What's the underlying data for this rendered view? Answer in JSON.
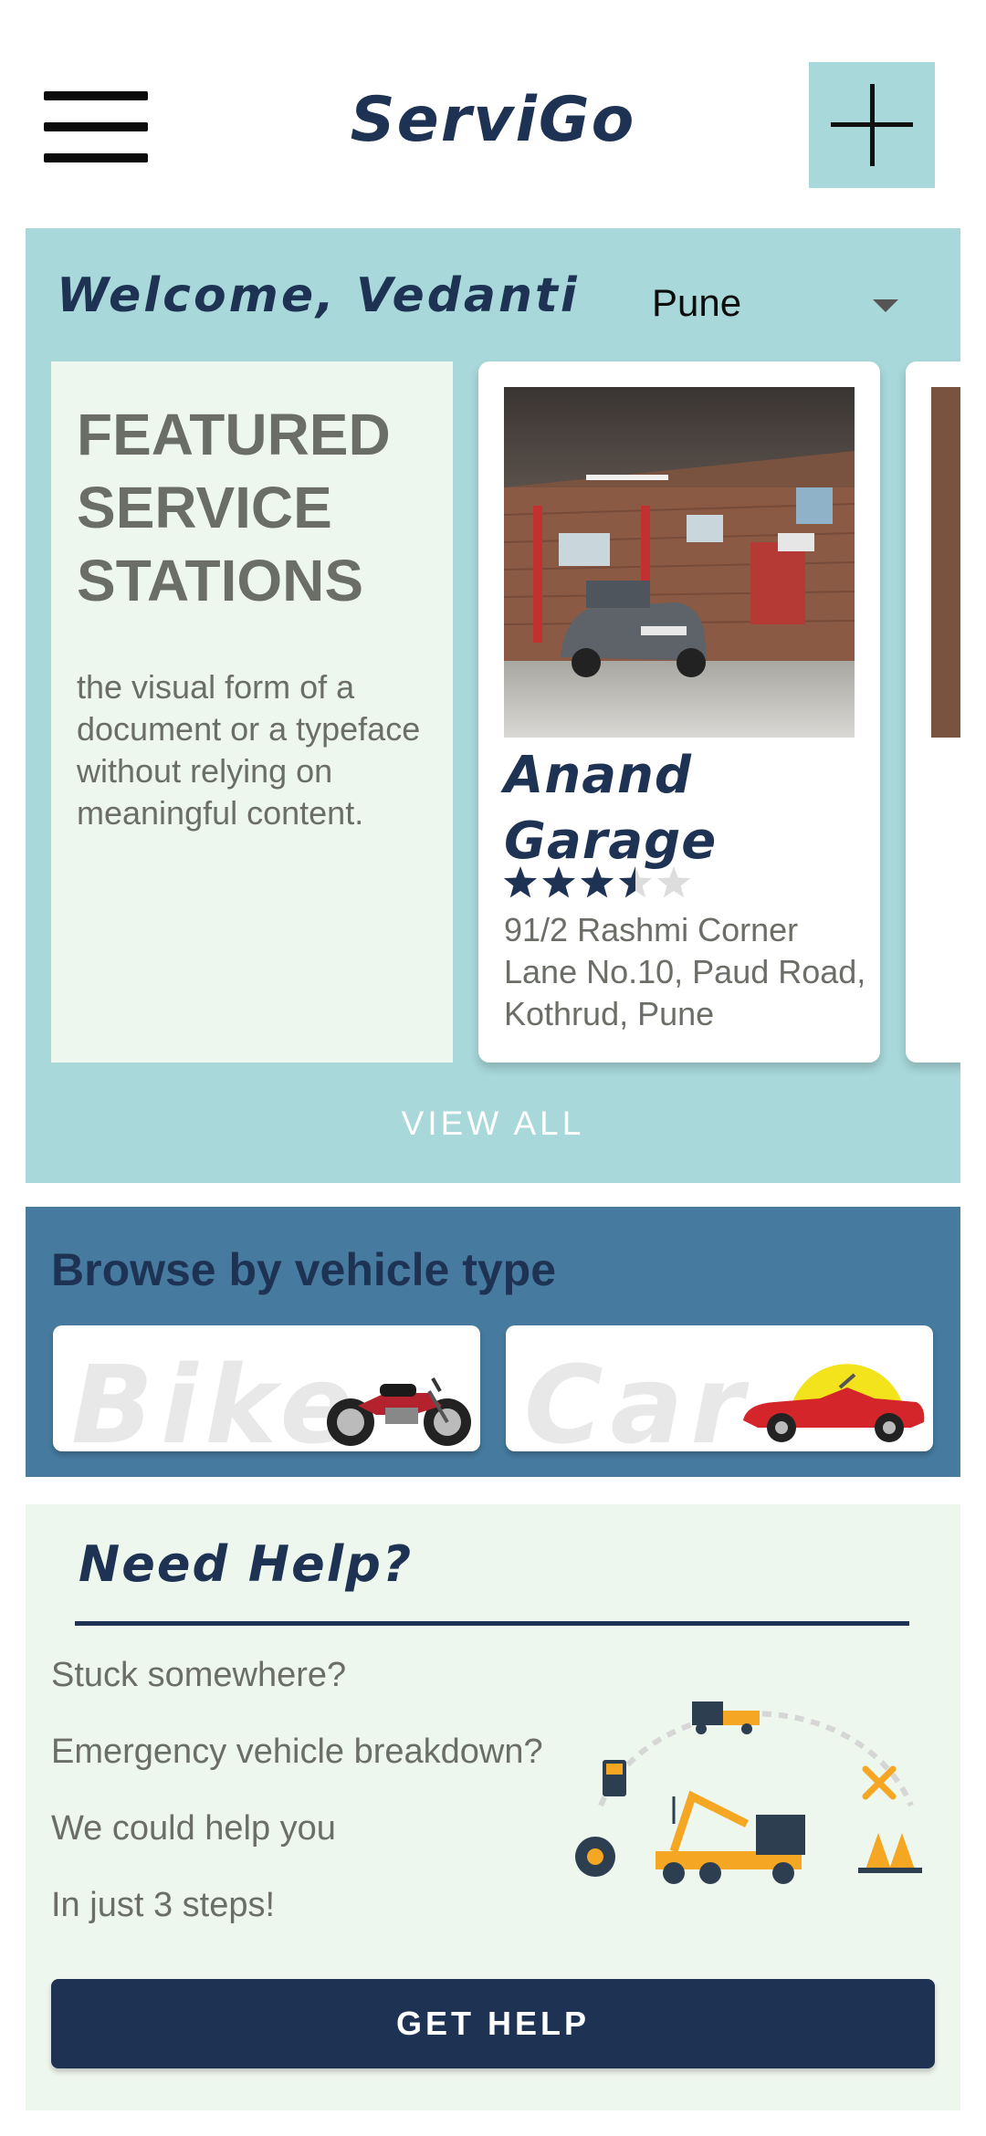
{
  "header": {
    "app_title": "ServiGo",
    "menu_icon": "hamburger-menu-icon",
    "add_icon": "plus-icon"
  },
  "featured": {
    "welcome": "Welcome, Vedanti",
    "city": "Pune",
    "heading": "FEATURED SERVICE STATIONS",
    "description": "the visual form of a document or a typeface without relying on meaningful content.",
    "stations": [
      {
        "name": "Anand Garage",
        "rating": 3.5,
        "max_rating": 5,
        "address": "91/2 Rashmi Corner Lane No.10, Paud Road, Kothrud, Pune"
      },
      {
        "name": "",
        "address": ""
      }
    ],
    "view_all_label": "VIEW ALL"
  },
  "browse": {
    "title": "Browse by vehicle type",
    "types": [
      {
        "label": "Bike",
        "icon": "motorcycle-icon"
      },
      {
        "label": "Car",
        "icon": "convertible-car-icon"
      }
    ]
  },
  "help": {
    "title": "Need Help?",
    "lines": [
      "Stuck somewhere?",
      "Emergency vehicle breakdown?",
      "We could help you",
      "In just 3 steps!"
    ],
    "button_label": "GET HELP"
  },
  "colors": {
    "brand_navy": "#1e3354",
    "panel_teal": "#a8d8da",
    "panel_blue": "#467a9e",
    "panel_mint": "#eef7ee",
    "star_empty": "#dddddd",
    "illustration_orange": "#f5a623"
  }
}
